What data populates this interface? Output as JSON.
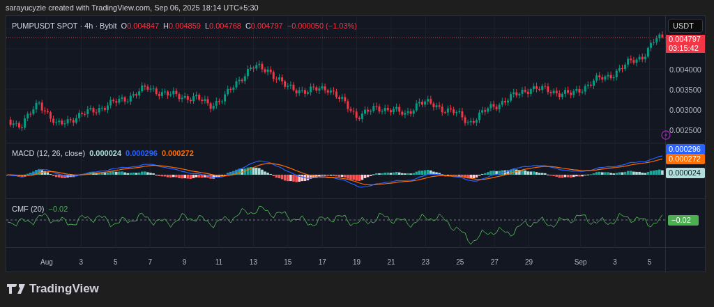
{
  "header": {
    "text": "sarayucyzie created with TradingView.com, Sep 06, 2025 18:14 UTC+5:30"
  },
  "legend": {
    "symbol": "PUMPUSDT SPOT · 4h · Bybit",
    "ohlc": [
      {
        "letter": "O",
        "value": "0.004847"
      },
      {
        "letter": "H",
        "value": "0.004859"
      },
      {
        "letter": "L",
        "value": "0.004768"
      },
      {
        "letter": "C",
        "value": "0.004797"
      }
    ],
    "change": "−0.000050 (−1.03%)"
  },
  "price_scale": {
    "currency": "USDT",
    "ticks": [
      "0.004000",
      "0.003500",
      "0.003000",
      "0.002500"
    ],
    "last_price": "0.004797",
    "countdown": "03:15:42"
  },
  "macd": {
    "title": "MACD (12, 26, close)",
    "values": [
      {
        "text": "0.000024",
        "color": "#b2dfdb"
      },
      {
        "text": "0.000296",
        "color": "#2962ff"
      },
      {
        "text": "0.000272",
        "color": "#ff6d00"
      }
    ],
    "labels": [
      {
        "text": "0.000296",
        "color": "#2962ff"
      },
      {
        "text": "0.000272",
        "color": "#ff6d00"
      },
      {
        "text": "0.000024",
        "color": "#b2dfdb"
      }
    ]
  },
  "cmf": {
    "title": "CMF (20)",
    "value": "−0.02",
    "label": "−0.02",
    "color": "#4caf50"
  },
  "time_axis": [
    "Aug",
    "3",
    "5",
    "7",
    "9",
    "11",
    "13",
    "15",
    "17",
    "19",
    "21",
    "23",
    "25",
    "27",
    "29",
    "Sep",
    "3",
    "5"
  ],
  "footer": {
    "brand": "TradingView"
  }
}
